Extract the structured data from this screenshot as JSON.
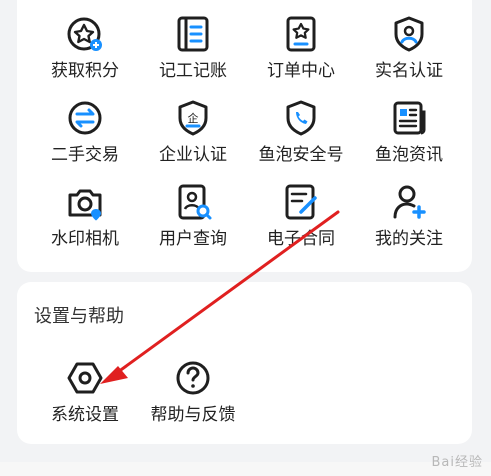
{
  "tools": {
    "items": [
      {
        "label": "获取积分",
        "icon": "points-icon"
      },
      {
        "label": "记工记账",
        "icon": "ledger-icon"
      },
      {
        "label": "订单中心",
        "icon": "order-icon"
      },
      {
        "label": "实名认证",
        "icon": "id-verify-icon"
      },
      {
        "label": "二手交易",
        "icon": "trade-icon"
      },
      {
        "label": "企业认证",
        "icon": "enterprise-icon"
      },
      {
        "label": "鱼泡安全号",
        "icon": "safe-number-icon"
      },
      {
        "label": "鱼泡资讯",
        "icon": "news-icon"
      },
      {
        "label": "水印相机",
        "icon": "camera-icon"
      },
      {
        "label": "用户查询",
        "icon": "user-search-icon"
      },
      {
        "label": "电子合同",
        "icon": "contract-icon"
      },
      {
        "label": "我的关注",
        "icon": "follow-icon"
      }
    ]
  },
  "settings_section": {
    "title": "设置与帮助",
    "items": [
      {
        "label": "系统设置",
        "icon": "settings-icon"
      },
      {
        "label": "帮助与反馈",
        "icon": "help-icon"
      }
    ]
  },
  "colors": {
    "icon": "#1f1f1f",
    "accent": "#1890ff",
    "arrow": "#e02020"
  },
  "watermark": "Bai经验"
}
